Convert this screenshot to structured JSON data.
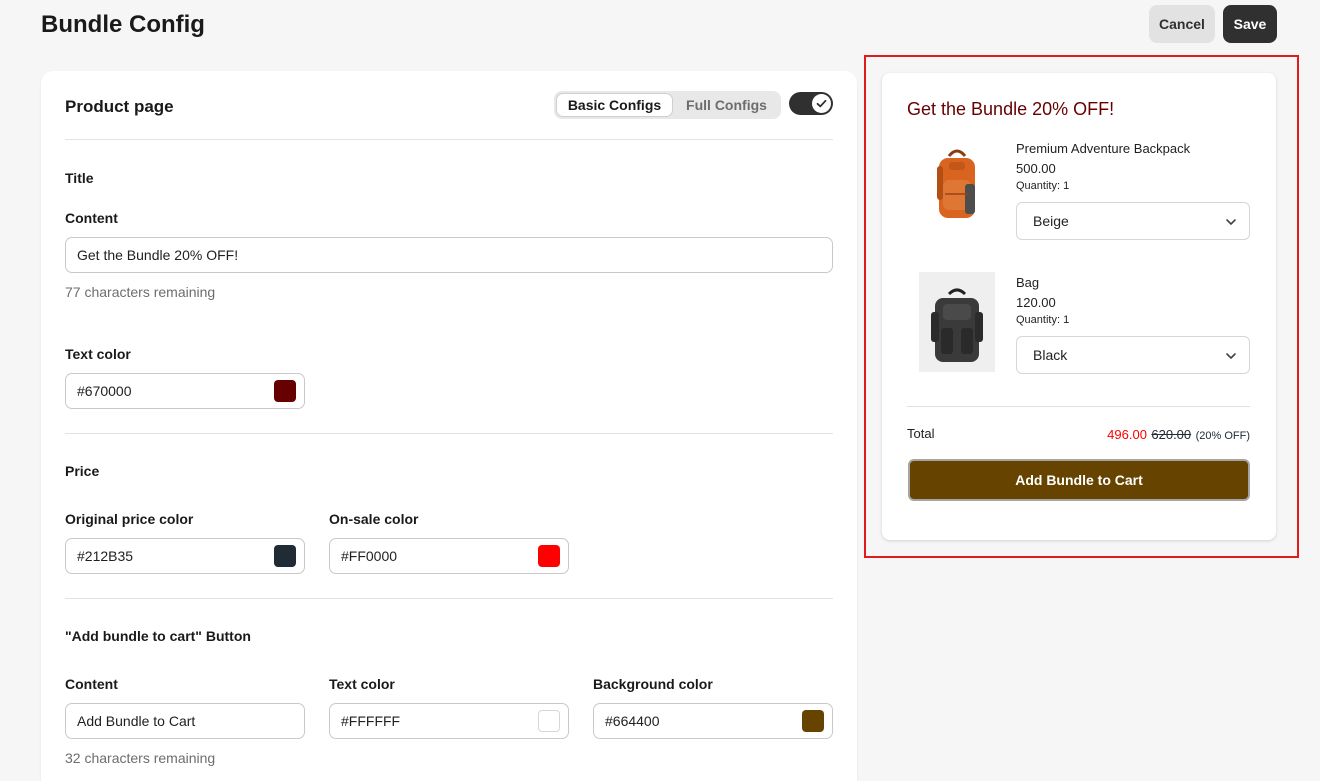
{
  "header": {
    "title": "Bundle Config",
    "cancel_label": "Cancel",
    "save_label": "Save"
  },
  "config": {
    "section_title": "Product page",
    "tabs": [
      {
        "label": "Basic Configs",
        "selected": true
      },
      {
        "label": "Full Configs",
        "selected": false
      }
    ],
    "toggle_on": true,
    "title_group": {
      "heading": "Title",
      "content_label": "Content",
      "content_value": "Get the Bundle 20% OFF!",
      "content_help": "77 characters remaining",
      "text_color_label": "Text color",
      "text_color_value": "#670000"
    },
    "price_group": {
      "heading": "Price",
      "original_label": "Original price color",
      "original_value": "#212B35",
      "sale_label": "On-sale color",
      "sale_value": "#FF0000"
    },
    "button_group": {
      "heading": "\"Add bundle to cart\" Button",
      "content_label": "Content",
      "content_value": "Add Bundle to Cart",
      "content_help": "32 characters remaining",
      "text_color_label": "Text color",
      "text_color_value": "#FFFFFF",
      "bg_color_label": "Background color",
      "bg_color_value": "#664400"
    }
  },
  "preview": {
    "title": "Get the Bundle 20% OFF!",
    "products": [
      {
        "name": "Premium Adventure Backpack",
        "price": "500.00",
        "quantity": "Quantity: 1",
        "variant": "Beige",
        "icon": "orange-backpack-image"
      },
      {
        "name": "Bag",
        "price": "120.00",
        "quantity": "Quantity: 1",
        "variant": "Black",
        "icon": "black-backpack-image"
      }
    ],
    "total_label": "Total",
    "sale_total": "496.00",
    "original_total": "620.00",
    "discount_text": "(20% OFF)",
    "button_label": "Add Bundle to Cart"
  },
  "colors": {
    "title": "#670000",
    "original_price": "#212B35",
    "sale_price": "#FF0000",
    "button_text": "#FFFFFF",
    "button_bg": "#664400",
    "highlight_frame": "#E01B1B"
  }
}
